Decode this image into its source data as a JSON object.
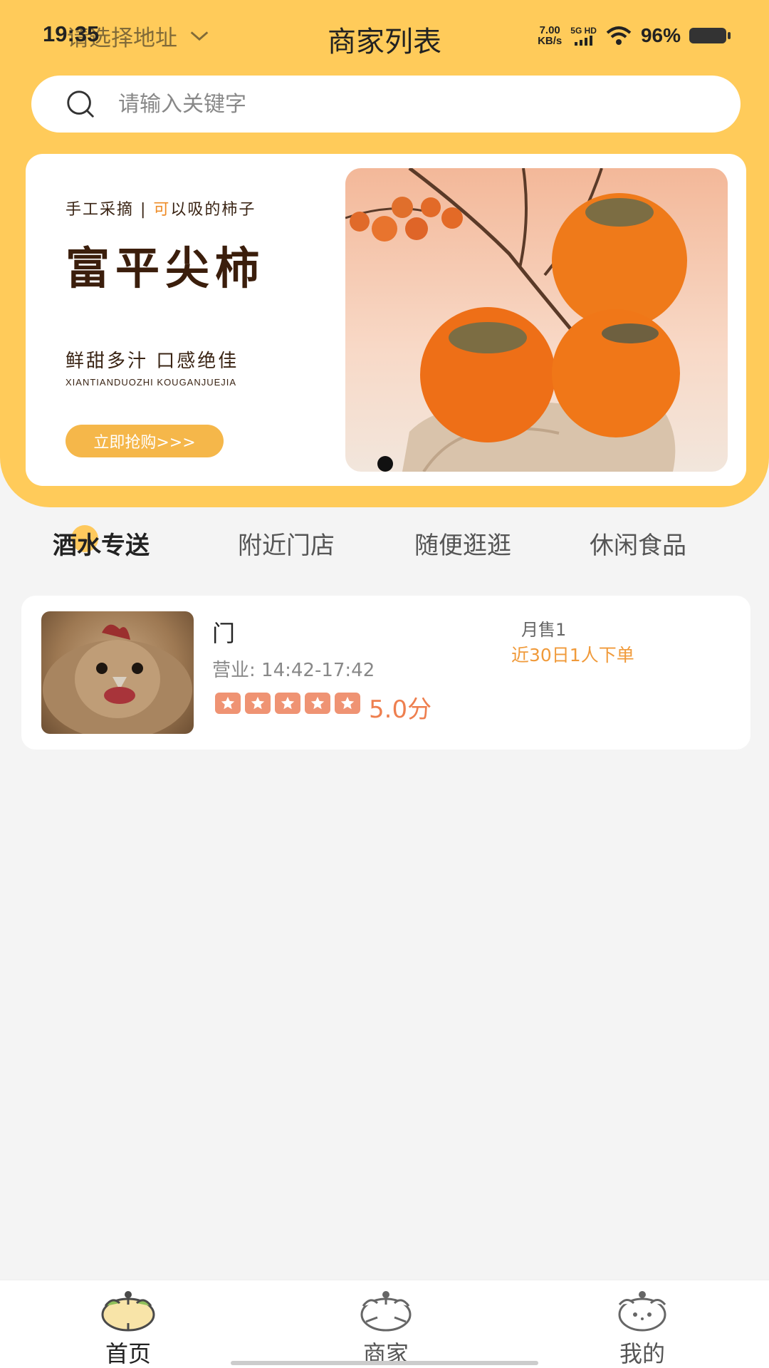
{
  "status_bar": {
    "time": "19:35",
    "net_speed_top": "7.00",
    "net_speed_bottom": "KB/s",
    "signal": "5G HD",
    "battery": "96%"
  },
  "header": {
    "address_label": "请选择地址",
    "title": "商家列表"
  },
  "search": {
    "placeholder": "请输入关键字"
  },
  "banner": {
    "line1_a": "手工采摘 | ",
    "line1_b": "可",
    "line1_c": "以吸的柿子",
    "title": "富平尖柿",
    "subtitle": "鲜甜多汁 口感绝佳",
    "pinyin": "XIANTIANDUOZHI KOUGANJUEJIA",
    "button": "立即抢购>>>"
  },
  "tabs": [
    {
      "label": "酒水专送",
      "active": true
    },
    {
      "label": "附近门店",
      "active": false
    },
    {
      "label": "随便逛逛",
      "active": false
    },
    {
      "label": "休闲食品",
      "active": false
    }
  ],
  "stores": [
    {
      "name": "门",
      "hours": "营业: 14:42-17:42",
      "rating_stars": 5,
      "score": "5.0分",
      "monthly_sales": "月售1",
      "orders": "近30日1人下单"
    }
  ],
  "bottom_nav": [
    {
      "label": "首页",
      "icon": "home-mascot-icon",
      "active": true
    },
    {
      "label": "商家",
      "icon": "store-mascot-icon",
      "active": false
    },
    {
      "label": "我的",
      "icon": "profile-mascot-icon",
      "active": false
    }
  ],
  "colors": {
    "header_yellow": "#ffcb5a",
    "accent_orange": "#ee7f4f",
    "star": "#ef9373"
  }
}
